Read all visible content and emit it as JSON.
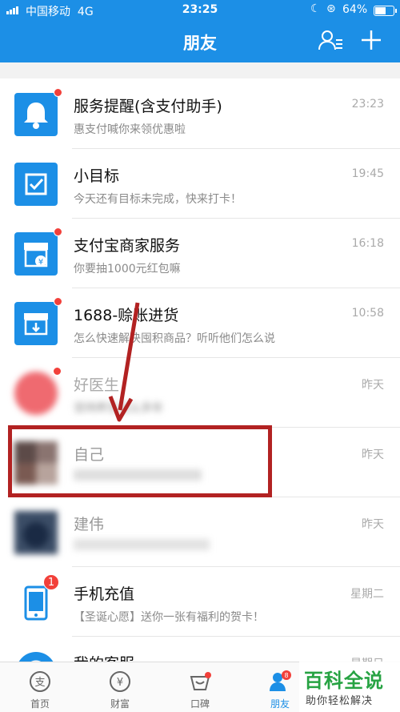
{
  "status_bar": {
    "carrier": "中国移动",
    "network": "4G",
    "time": "23:25",
    "battery": "64%",
    "battery_level": 0.64
  },
  "header": {
    "title": "朋友",
    "contacts_icon": "contacts-icon",
    "add_icon": "plus-icon"
  },
  "messages": [
    {
      "name": "服务提醒(含支付助手)",
      "preview": "惠支付喊你来领优惠啦",
      "time": "23:23",
      "icon": "bell-icon",
      "unread_dot": true
    },
    {
      "name": "小目标",
      "preview": "今天还有目标未完成，快来打卡！",
      "time": "19:45",
      "icon": "checkbox-icon",
      "unread_dot": false
    },
    {
      "name": "支付宝商家服务",
      "preview": "你要抽1000元红包嘛",
      "time": "16:18",
      "icon": "shop-icon",
      "unread_dot": true
    },
    {
      "name": "1688-赊账进货",
      "preview": "怎么快速解决囤积商品？听听他们怎么说",
      "time": "10:58",
      "icon": "box-icon",
      "unread_dot": true
    },
    {
      "name": "好医生",
      "preview": "坚持养生这么多年",
      "time": "昨天",
      "icon": "avatar",
      "unread_dot": true,
      "blurred": true
    },
    {
      "name": "自己",
      "preview": "",
      "time": "昨天",
      "icon": "avatar",
      "unread_dot": false,
      "blurred": true
    },
    {
      "name": "建伟",
      "preview": "",
      "time": "昨天",
      "icon": "avatar",
      "unread_dot": false,
      "blurred": true
    },
    {
      "name": "手机充值",
      "preview": "【圣诞心愿】送你一张有福利的贺卡！",
      "time": "星期二",
      "icon": "phone-icon",
      "badge": "1"
    },
    {
      "name": "我的客服",
      "preview": "",
      "time": "星期日",
      "icon": "headset-icon",
      "unread_dot": false
    }
  ],
  "tabbar": {
    "tabs": [
      {
        "label": "首页",
        "icon": "alipay-home-icon"
      },
      {
        "label": "财富",
        "icon": "wealth-icon"
      },
      {
        "label": "口碑",
        "icon": "koubei-icon"
      },
      {
        "label": "朋友",
        "icon": "friends-icon",
        "badge": "8"
      }
    ]
  },
  "watermark": {
    "logo": "百科全说",
    "sub": "助你轻松解决"
  },
  "colors": {
    "brand_blue": "#1c8fe6",
    "unread_red": "#f2403a",
    "annotation_red": "#b22222",
    "watermark_green": "#27a343"
  }
}
